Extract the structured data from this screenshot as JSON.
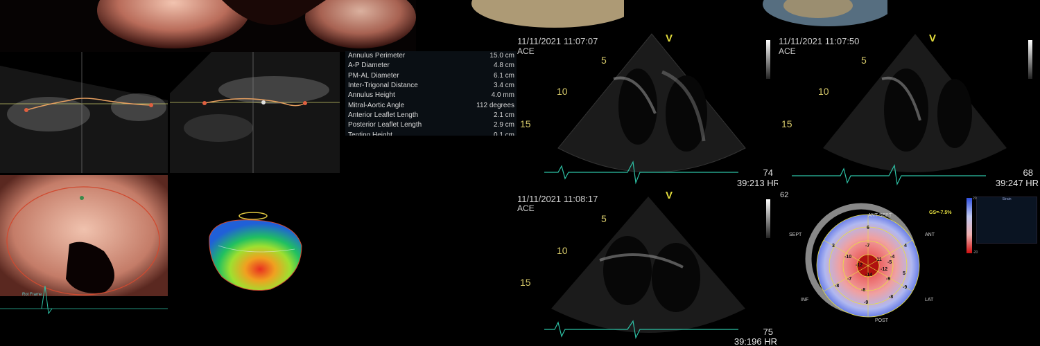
{
  "measurements": {
    "rows": [
      {
        "label": "Annulus Perimeter",
        "value": "15.0 cm"
      },
      {
        "label": "A-P Diameter",
        "value": "4.8 cm"
      },
      {
        "label": "PM-AL Diameter",
        "value": "6.1 cm"
      },
      {
        "label": "Inter-Trigonal Distance",
        "value": "3.4 cm"
      },
      {
        "label": "Annulus Height",
        "value": "4.0 mm"
      },
      {
        "label": "Mitral-Aortic Angle",
        "value": "112 degrees"
      },
      {
        "label": "Anterior Leaflet Length",
        "value": "2.1 cm"
      },
      {
        "label": "Posterior Leaflet Length",
        "value": "2.9 cm"
      },
      {
        "label": "Tenting Height",
        "value": "0.1 cm"
      }
    ]
  },
  "echo_views": [
    {
      "timestamp": "11/11/2021 11:07:07",
      "label": "ACE",
      "hr": "74",
      "hr_detail": "39:213 HR",
      "depth_marks": [
        "5",
        "10",
        "15"
      ],
      "marker": "V"
    },
    {
      "timestamp": "11/11/2021 11:07:50",
      "label": "ACE",
      "hr": "68",
      "hr_detail": "39:247 HR",
      "depth_marks": [
        "5",
        "10",
        "15"
      ],
      "marker": "V"
    },
    {
      "timestamp": "11/11/2021 11:08:17",
      "label": "ACE",
      "hr": "75",
      "hr_detail": "39:196 HR",
      "depth_marks": [
        "5",
        "10",
        "15"
      ],
      "marker": "V"
    }
  ],
  "bullseye": {
    "top_number": "62",
    "gs_label": "GS=-7.5%",
    "labels": {
      "ant_sept": "ANT SEPT",
      "ant": "ANT",
      "sept": "SEPT",
      "lat": "LAT",
      "inf": "INF",
      "post": "POST"
    },
    "segment_values": [
      "6",
      "3",
      "4",
      "-7",
      "-10",
      "-4",
      "-5",
      "-12",
      "-11",
      "-14",
      "-7",
      "-8",
      "-12",
      "-9",
      "-8",
      "-8",
      "-9",
      "5",
      "-9"
    ],
    "legend_title": "Strain",
    "scale_top": "20",
    "scale_bottom": "-20"
  },
  "annulus_3d": {
    "label": "Rot Frame"
  },
  "colors": {
    "spline": "#e7a060",
    "ecg": "#2ec2a6",
    "depth_text": "#d6c96a",
    "accent_marker": "#e2dc3c"
  }
}
